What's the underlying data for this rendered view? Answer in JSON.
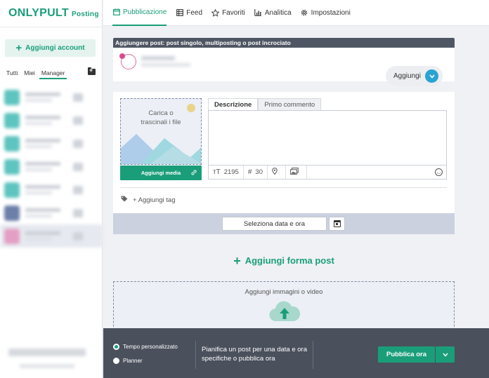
{
  "logo": {
    "brand": "ONLYPULT",
    "sub": "Posting"
  },
  "sidebar": {
    "add_account_label": "Aggiungi account",
    "filters": [
      "Tutti",
      "Miei",
      "Manager"
    ],
    "active_filter": "Manager",
    "account_avatar_colors": [
      "#5ec4bf",
      "#5ec4bf",
      "#5ec4bf",
      "#5ec4bf",
      "#5ec4bf",
      "#6b7fa8",
      "#e4a0c4"
    ]
  },
  "nav": {
    "items": [
      {
        "label": "Pubblicazione",
        "icon": "calendar-icon",
        "active": true
      },
      {
        "label": "Feed",
        "icon": "grid-icon",
        "active": false
      },
      {
        "label": "Favoriti",
        "icon": "star-icon",
        "active": false
      },
      {
        "label": "Analitica",
        "icon": "chart-icon",
        "active": false
      },
      {
        "label": "Impostazioni",
        "icon": "gear-icon",
        "active": false
      }
    ]
  },
  "post": {
    "header": "Aggiungere post: post singolo, multiposting o post incrociato",
    "add_pill_label": "Aggiungi",
    "upload_text_line1": "Carica o",
    "upload_text_line2": "trascinali i file",
    "add_media_label": "Aggiungi media",
    "tabs": [
      "Descrizione",
      "Primo commento"
    ],
    "active_tab": "Descrizione",
    "char_count": "2195",
    "hashtag_count": "30",
    "add_tag_label": "+ Aggiungi tag",
    "date_button_label": "Seleziona data e ora"
  },
  "add_form_label": "Aggiungi forma post",
  "media_drop_label": "Aggiungi immagini o video",
  "bottom": {
    "option_custom": "Tempo personalizzato",
    "option_planner": "Planner",
    "selected_option": "Tempo personalizzato",
    "description": "Pianifica un post per una data e ora specifiche o pubblica ora",
    "publish_label": "Pubblica ora"
  },
  "colors": {
    "accent": "#1a9e7a",
    "header_dark": "#4f5663",
    "bottom_bar": "#4a505c",
    "date_bar": "#ccd1e0",
    "pill_circle": "#29a3d1"
  }
}
